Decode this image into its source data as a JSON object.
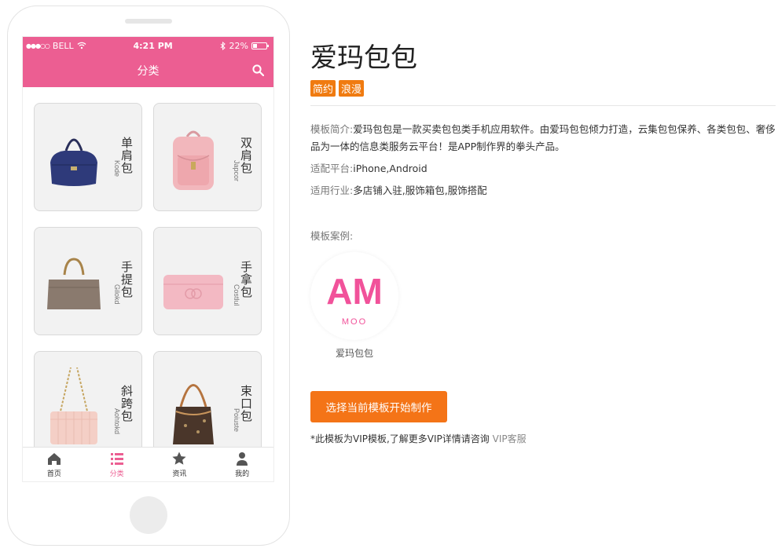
{
  "phone": {
    "status": {
      "carrier": "BELL",
      "time": "4:21 PM",
      "battery": "22%"
    },
    "nav_title": "分类",
    "categories": [
      {
        "name": "单肩包",
        "en": "Kode"
      },
      {
        "name": "双肩包",
        "en": "Japcor"
      },
      {
        "name": "手提包",
        "en": "Gilokd"
      },
      {
        "name": "手拿包",
        "en": "Costlul"
      },
      {
        "name": "斜跨包",
        "en": "Aohtokd"
      },
      {
        "name": "束口包",
        "en": "Poiuste"
      }
    ],
    "tabs": [
      {
        "label": "首页"
      },
      {
        "label": "分类"
      },
      {
        "label": "资讯"
      },
      {
        "label": "我的"
      }
    ]
  },
  "detail": {
    "title": "爱玛包包",
    "tags": [
      "简约",
      "浪漫"
    ],
    "intro_label": "模板简介:",
    "intro": "爱玛包包是一款买卖包包类手机应用软件。由爱玛包包倾力打造，云集包包保养、各类包包、奢侈品为一体的信息类服务云平台！是APP制作界的拳头产品。",
    "platform_label": "适配平台:",
    "platform": "iPhone,Android",
    "industry_label": "适用行业:",
    "industry": "多店铺入驻,服饰箱包,服饰搭配",
    "case_label": "模板案例:",
    "case_logo_text": "AM",
    "case_logo_sub": "MOO",
    "case_name": "爱玛包包",
    "start_button": "选择当前模板开始制作",
    "vip_note": "*此模板为VIP模板,了解更多VIP详情请咨询",
    "vip_link": "VIP客服"
  },
  "colors": {
    "accent_pink": "#ec5e92",
    "orange": "#f47417"
  }
}
